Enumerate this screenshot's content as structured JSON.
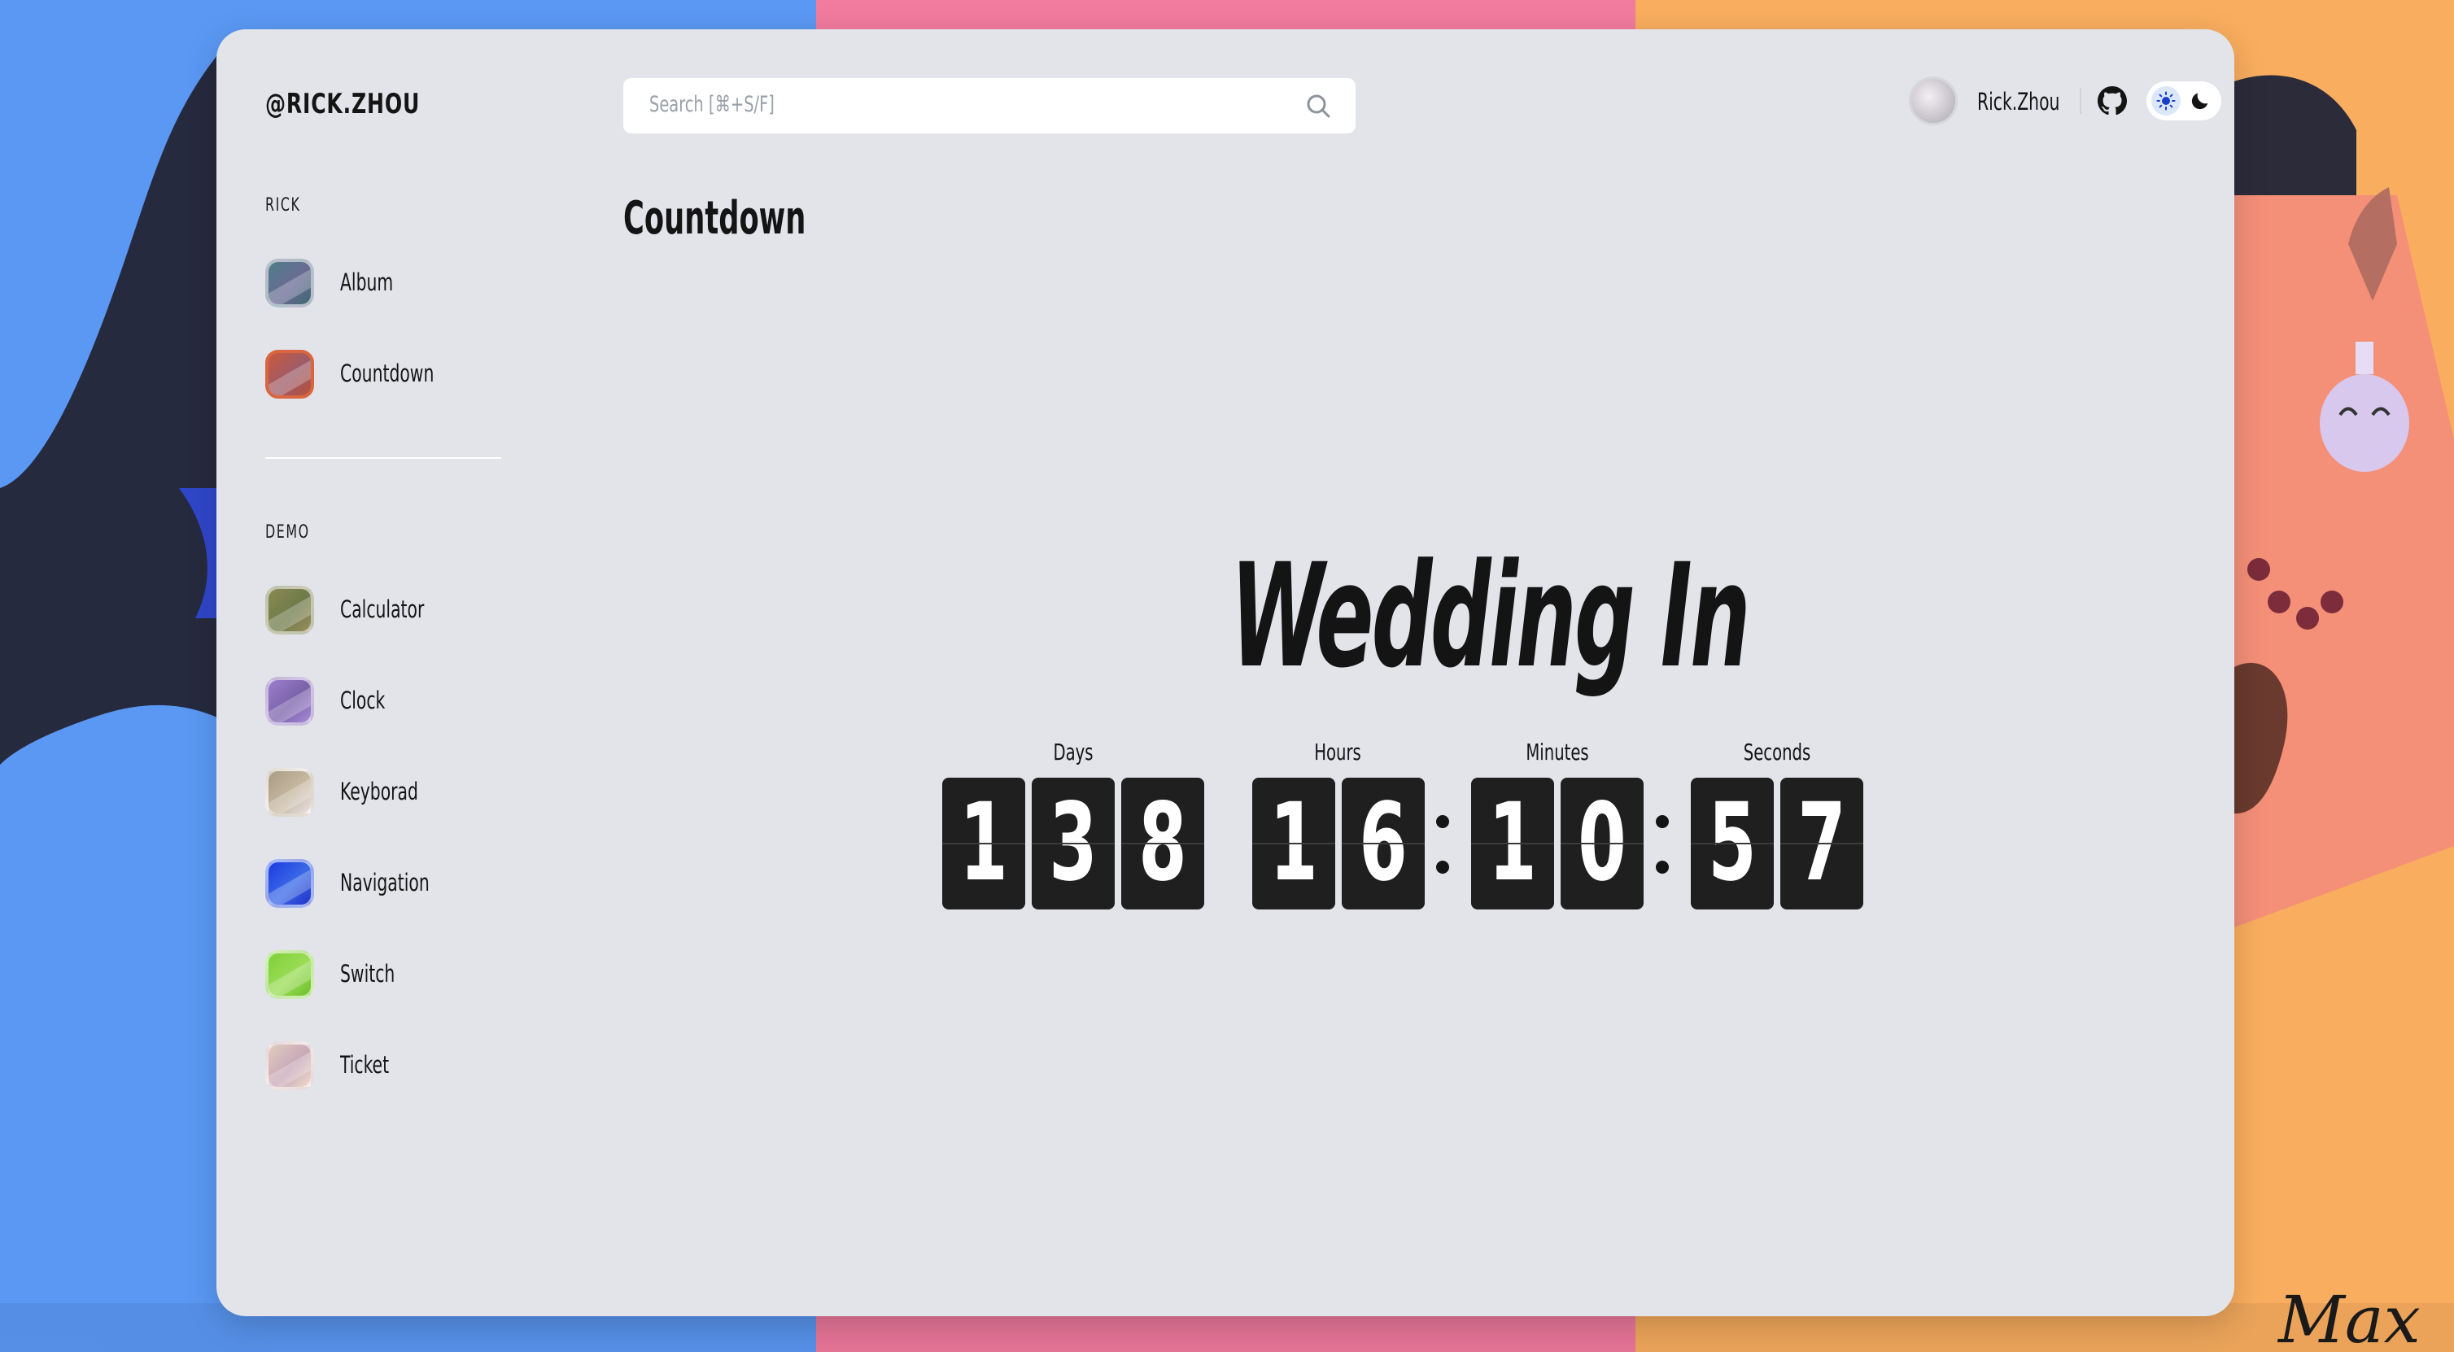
{
  "app": {
    "logo": "@RICK.ZHOU"
  },
  "search": {
    "placeholder": "Search [⌘+S/F]"
  },
  "user": {
    "name": "Rick.Zhou"
  },
  "sidebar": {
    "sections": [
      {
        "label": "RICK",
        "items": [
          {
            "label": "Album",
            "color": "#5f7f8a"
          },
          {
            "label": "Countdown",
            "color": "#b9614a"
          }
        ]
      },
      {
        "label": "DEMO",
        "items": [
          {
            "label": "Calculator",
            "color": "#8a8a55"
          },
          {
            "label": "Clock",
            "color": "#8d74b8"
          },
          {
            "label": "Keyborad",
            "color": "#b7aa98"
          },
          {
            "label": "Navigation",
            "color": "#2a45d8"
          },
          {
            "label": "Switch",
            "color": "#7fcc3c"
          },
          {
            "label": "Ticket",
            "color": "#d6c0b4"
          }
        ]
      }
    ]
  },
  "page": {
    "title": "Countdown"
  },
  "countdown": {
    "heading": "Wedding In",
    "units": [
      {
        "label": "Days",
        "digits": [
          "1",
          "3",
          "8"
        ]
      },
      {
        "label": "Hours",
        "digits": [
          "1",
          "6"
        ]
      },
      {
        "label": "Minutes",
        "digits": [
          "1",
          "0"
        ]
      },
      {
        "label": "Seconds",
        "digits": [
          "5",
          "7"
        ]
      }
    ]
  },
  "colors": {
    "bg_blue": "#5b98f4",
    "bg_pink": "#f27ba0",
    "bg_orange": "#f9ae5f",
    "window": "#e2e4ea",
    "digit_card": "#1f1f1f"
  },
  "icons": [
    "search-icon",
    "github-icon",
    "sun-icon",
    "moon-icon"
  ]
}
